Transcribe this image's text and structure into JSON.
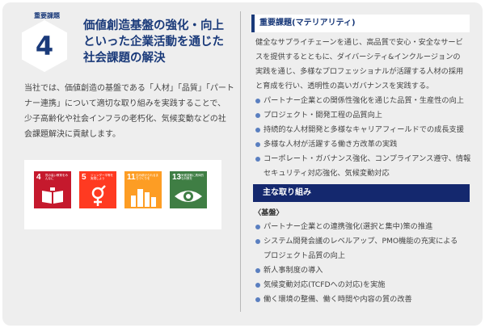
{
  "section": {
    "label": "重要課題",
    "number": "4",
    "title_lines": [
      "価値創造基盤の強化・向上",
      "といった企業活動を通じた",
      "社会課題の解決"
    ]
  },
  "intro_lines": [
    "当社では、価値創造の基盤である「人材」「品質」「パート",
    "ナー連携」について適切な取り組みを実践することで、",
    "少子高齢化や社会インフラの老朽化、気候変動などの社",
    "会課題解決に貢献します。"
  ],
  "sdgs": [
    {
      "number": "4",
      "text": "質の高い教育をみんなに",
      "color": "#c5192d",
      "icon": "book-icon"
    },
    {
      "number": "5",
      "text": "ジェンダー平等を実現しよう",
      "color": "#ff3a21",
      "icon": "gender-icon"
    },
    {
      "number": "11",
      "text": "住み続けられるまちづくりを",
      "color": "#fd9d24",
      "icon": "city-icon"
    },
    {
      "number": "13",
      "text": "気候変動に具体的な対策を",
      "color": "#3f7e44",
      "icon": "eye-globe-icon"
    }
  ],
  "materiality": {
    "heading": "重要課題(マテリアリティ)",
    "intro_lines": [
      "健全なサプライチェーンを通じ、高品質で安心・安全なサービ",
      "スを提供するとともに、ダイバーシティ&インクルージョンの",
      "実践を通じ、多様なプロフェッショナルが活躍する人材の採用",
      "と育成を行い、透明性の高いガバナンスを実践する。"
    ],
    "items": [
      [
        "パートナー企業との関係性強化を通じた品質・生産性の向上"
      ],
      [
        "プロジェクト・開発工程の品質向上"
      ],
      [
        "持続的な人材開発と多様なキャリアフィールドでの成長支援"
      ],
      [
        "多様な人材が活躍する働き方改革の実践"
      ],
      [
        "コーポレート・ガバナンス強化、コンプライアンス遵守、情報",
        "セキュリティ対応強化、気候変動対応"
      ]
    ]
  },
  "initiatives": {
    "heading": "主な取り組み",
    "subheading": "〈基盤〉",
    "items": [
      [
        "パートナー企業との連携強化(選択と集中)策の推進"
      ],
      [
        "システム開発会議のレベルアップ、PMO機能の充実による",
        "プロジェクト品質の向上"
      ],
      [
        "新人事制度の導入"
      ],
      [
        "気候変動対応(TCFDへの対応)を実施"
      ],
      [
        "働く環境の整備、働く時間や内容の質の改善"
      ]
    ]
  }
}
